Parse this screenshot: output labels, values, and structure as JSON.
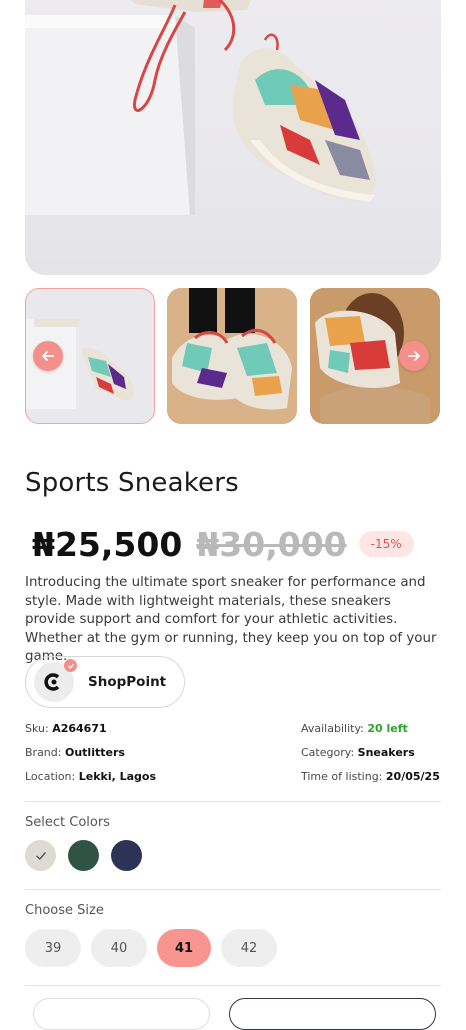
{
  "product": {
    "title": "Sports Sneakers",
    "price": "₦25,500",
    "old_price": "₦30,000",
    "discount": "-15%",
    "description": "Introducing the ultimate sport sneaker for performance and style. Made with lightweight materials, these sneakers provide support and comfort for your athletic activities. Whether at the gym or running, they keep you on top of your game."
  },
  "store": {
    "name": "ShopPoint"
  },
  "meta": {
    "sku_label": "Sku:",
    "sku": "A264671",
    "brand_label": "Brand:",
    "brand": "Outlitters",
    "location_label": "Location:",
    "location": "Lekki, Lagos",
    "availability_label": "Availability:",
    "availability": "20 left",
    "category_label": "Category:",
    "category": "Sneakers",
    "listing_label": "Time of listing:",
    "listing": "20/05/25"
  },
  "colors": {
    "label": "Select Colors",
    "options": [
      "#dedbd3",
      "#2f5445",
      "#2d3357"
    ],
    "selected": 0
  },
  "sizes": {
    "label": "Choose Size",
    "options": [
      "39",
      "40",
      "41",
      "42"
    ],
    "selected": "41"
  },
  "accent": "#f4908c"
}
